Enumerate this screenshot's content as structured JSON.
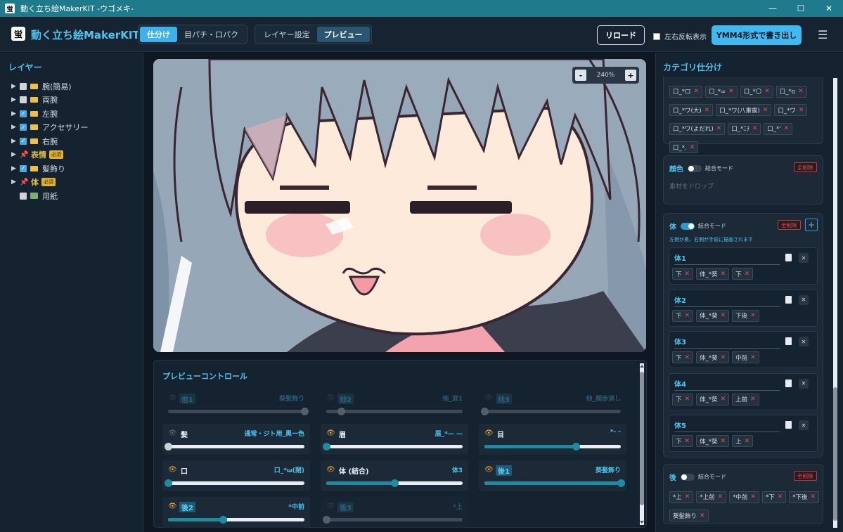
{
  "window": {
    "title": "動く立ち絵MakerKIT -ウゴメキ-",
    "logo_char": "蛍",
    "minimize": "—",
    "maximize": "☐",
    "close": "✕"
  },
  "header": {
    "app_title": "動く立ち絵MakerKIT",
    "logo_char": "蛍",
    "mode_tabs": [
      {
        "label": "仕分け",
        "active": true
      },
      {
        "label": "目パチ・口パク",
        "active": false
      }
    ],
    "view_tabs": [
      {
        "label": "レイヤー設定",
        "active": false
      },
      {
        "label": "プレビュー",
        "active": true
      }
    ],
    "reload_label": "リロード",
    "mirror_label": "左右反転表示",
    "export_label": "YMM4形式で書き出し",
    "menu_icon": "☰"
  },
  "layers": {
    "title": "レイヤー",
    "items": [
      {
        "label": "腕(簡易)",
        "checked": false,
        "type": "folder"
      },
      {
        "label": "両腕",
        "checked": false,
        "type": "folder"
      },
      {
        "label": "左腕",
        "checked": true,
        "type": "folder"
      },
      {
        "label": "アクセサリー",
        "checked": true,
        "type": "folder"
      },
      {
        "label": "右腕",
        "checked": true,
        "type": "folder"
      },
      {
        "label": "表情",
        "type": "required",
        "badge": "必須"
      },
      {
        "label": "髪飾り",
        "checked": true,
        "type": "folder"
      },
      {
        "label": "体",
        "type": "required",
        "badge": "必須"
      },
      {
        "label": "用紙",
        "checked": false,
        "type": "paper"
      }
    ]
  },
  "preview": {
    "zoom": "240%",
    "zoom_minus": "-",
    "zoom_plus": "+"
  },
  "controls": {
    "title": "プレビューコントロール",
    "sliders": [
      {
        "label": "他1",
        "value": "葵髪飾り",
        "level": 1.0,
        "enabled": false,
        "highlight": true
      },
      {
        "label": "他2",
        "value": "他_涙1",
        "level": 0.11,
        "enabled": false,
        "highlight": true
      },
      {
        "label": "他3",
        "value": "他_顔赤消し",
        "level": 0.0,
        "enabled": false,
        "highlight": true
      },
      {
        "label": "髪",
        "value": "通常・ジト用_黒一色",
        "level": 0.0,
        "enabled": true,
        "eye": false,
        "highlight": false
      },
      {
        "label": "眉",
        "value": "眉_*— —",
        "level": 0.0,
        "enabled": true,
        "eye": true,
        "highlight": false
      },
      {
        "label": "目",
        "value": "*- -",
        "level": 0.67,
        "enabled": true,
        "eye": true,
        "highlight": false
      },
      {
        "label": "口",
        "value": "口_*ω(閉)",
        "level": 0.0,
        "enabled": true,
        "eye": true,
        "highlight": false
      },
      {
        "label": "体 (結合)",
        "value": "体3",
        "level": 0.5,
        "enabled": true,
        "eye": true,
        "highlight": false
      },
      {
        "label": "後1",
        "value": "葵髪飾り",
        "level": 1.0,
        "enabled": true,
        "eye": true,
        "highlight": true
      },
      {
        "label": "後2",
        "value": "*中前",
        "level": 0.4,
        "enabled": true,
        "eye": true,
        "highlight": true
      },
      {
        "label": "後3",
        "value": "*上",
        "level": 0.0,
        "enabled": false,
        "eye": false,
        "highlight": true
      }
    ]
  },
  "categories": {
    "title": "カテゴリ仕分け",
    "mouth_tags": [
      "口_*ロ",
      "口_*∞",
      "口_*〇",
      "口_*o",
      "口_*ワ(大)",
      "口_*ワ(八重歯)",
      "口_*ワ",
      "口_*ワ(よだれ)",
      "口_*ﾆｦ",
      "口_*'",
      "口_*."
    ],
    "color": {
      "name": "顔色",
      "merge_label": "結合モード",
      "delete_label": "全削除",
      "drop_hint": "素材をドロップ"
    },
    "body": {
      "name": "体",
      "merge_label": "結合モード",
      "delete_label": "全削除",
      "add_label": "+",
      "note": "左側が奥、右側が手前に描画されます",
      "items": [
        {
          "name": "体1",
          "tags": [
            "下",
            "体_*葵",
            "下"
          ]
        },
        {
          "name": "体2",
          "tags": [
            "下",
            "体_*葵",
            "下後"
          ]
        },
        {
          "name": "体3",
          "tags": [
            "下",
            "体_*葵",
            "中前"
          ]
        },
        {
          "name": "体4",
          "tags": [
            "下",
            "体_*葵",
            "上前"
          ]
        },
        {
          "name": "体5",
          "tags": [
            "下",
            "体_*葵",
            "上"
          ]
        }
      ]
    },
    "back": {
      "name": "後",
      "merge_label": "結合モード",
      "delete_label": "全削除",
      "tags": [
        "*上",
        "*上前",
        "*中前",
        "*下",
        "*下後",
        "葵髪飾り"
      ]
    }
  }
}
